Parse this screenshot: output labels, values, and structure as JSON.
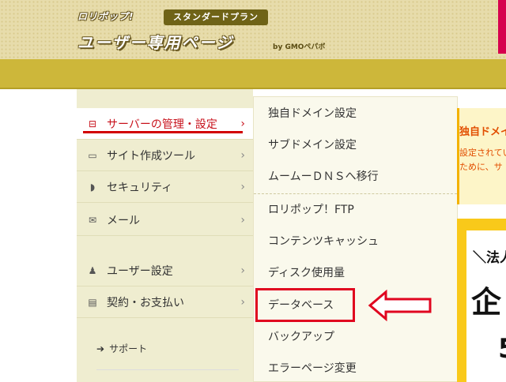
{
  "header": {
    "logo_small": "ロリポップ!",
    "plan_badge": "スタンダードプラン",
    "logo_main": "ユーザー専用ページ",
    "gmo": "by GMOペパボ"
  },
  "sidebar": {
    "items": [
      {
        "label": "サーバーの管理・設定",
        "icon": "server-icon",
        "glyph": "⊟"
      },
      {
        "label": "サイト作成ツール",
        "icon": "laptop-icon",
        "glyph": "▭"
      },
      {
        "label": "セキュリティ",
        "icon": "shield-icon",
        "glyph": "◗"
      },
      {
        "label": "メール",
        "icon": "mail-icon",
        "glyph": "✉"
      },
      {
        "label": "ユーザー設定",
        "icon": "user-icon",
        "glyph": "♟"
      },
      {
        "label": "契約・お支払い",
        "icon": "credit-card-icon",
        "glyph": "▤"
      }
    ],
    "chevron": "›",
    "support": "サポート",
    "support_arrow": "➔"
  },
  "dropdown": {
    "items": [
      "独自ドメイン設定",
      "サブドメイン設定",
      "ムームーＤＮＳへ移行",
      "ロリポップ！FTP",
      "コンテンツキャッシュ",
      "ディスク使用量",
      "データベース",
      "バックアップ",
      "エラーページ変更"
    ]
  },
  "notice": {
    "title": "独自ドメイ",
    "line1": "設定されてい",
    "line2": "ために、サ"
  },
  "promo": {
    "line1": "＼法人",
    "line2": "企",
    "line3": "5"
  },
  "colors": {
    "accent_red": "#d20000",
    "header_band": "#cdb73a",
    "sidebar_bg": "#efedd0"
  }
}
